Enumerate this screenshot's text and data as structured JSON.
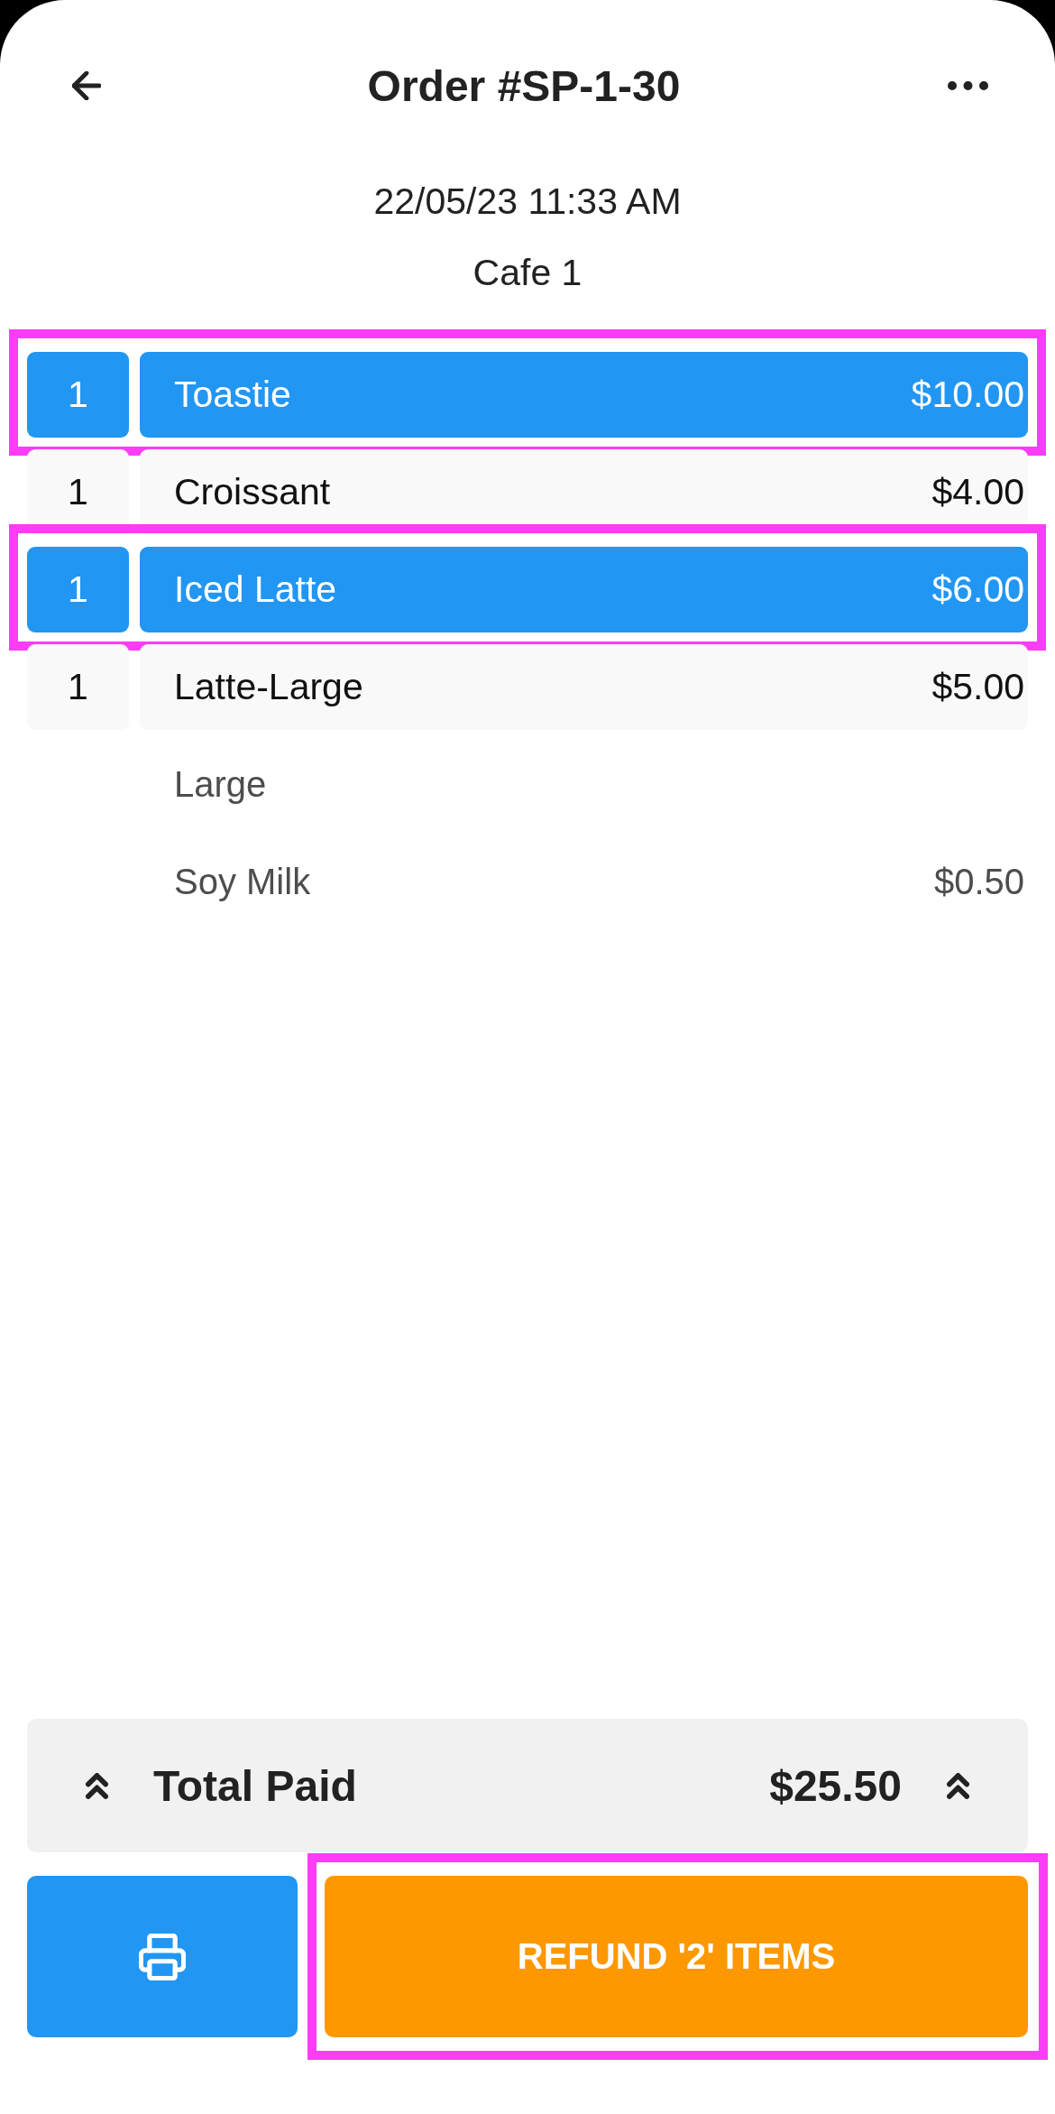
{
  "header": {
    "title": "Order #SP-1-30"
  },
  "order_info": {
    "datetime": "22/05/23 11:33 AM",
    "location": "Cafe 1"
  },
  "items": [
    {
      "quantity": "1",
      "name": "Toastie",
      "price": "$10.00",
      "selected": true,
      "highlighted": true
    },
    {
      "quantity": "1",
      "name": "Croissant",
      "price": "$4.00",
      "selected": false,
      "highlighted": false
    },
    {
      "quantity": "1",
      "name": "Iced Latte",
      "price": "$6.00",
      "selected": true,
      "highlighted": true
    },
    {
      "quantity": "1",
      "name": "Latte-Large",
      "price": "$5.00",
      "selected": false,
      "highlighted": false,
      "modifiers": [
        {
          "name": "Large"
        },
        {
          "name": "Soy Milk",
          "price": "$0.50"
        }
      ]
    }
  ],
  "total": {
    "label": "Total Paid",
    "amount": "$25.50"
  },
  "actions": {
    "refund": {
      "label": "REFUND '2' ITEMS",
      "highlighted": true
    }
  }
}
